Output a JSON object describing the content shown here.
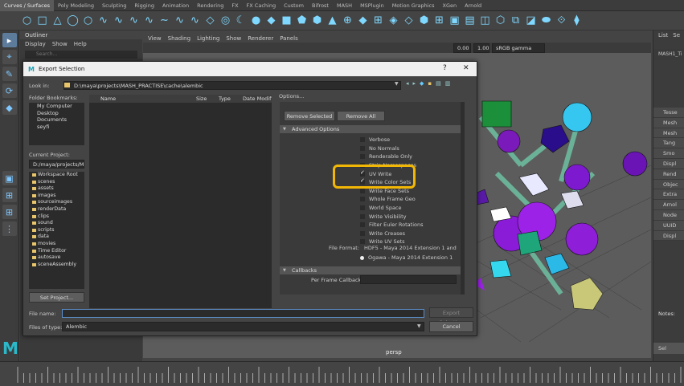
{
  "shelf": {
    "tabs": [
      "Curves / Surfaces",
      "Poly Modeling",
      "Sculpting",
      "Rigging",
      "Animation",
      "Rendering",
      "FX",
      "FX Caching",
      "Custom",
      "Bifrost",
      "MASH",
      "MSPlugin",
      "Motion Graphics",
      "XGen",
      "Arnold"
    ],
    "active_tab": "Curves / Surfaces",
    "icons": [
      "○",
      "□",
      "△",
      "◯",
      "○",
      "∿",
      "∿",
      "∿",
      "∿",
      "∼",
      "∿",
      "∿",
      "◇",
      "◎",
      "☾",
      "●",
      "◆",
      "■",
      "⬟",
      "⬢",
      "▲",
      "⊕",
      "◆",
      "⊞",
      "◈",
      "◇",
      "⬢",
      "⊞",
      "▣",
      "▤",
      "◫",
      "⬡",
      "⧉",
      "◪",
      "⬬",
      "⟐",
      "⧫"
    ]
  },
  "toolbox": {
    "tools": [
      "▸",
      "⌖",
      "✎",
      "⟳",
      "◆",
      "▣",
      "⊞",
      "⊞",
      "⋮"
    ]
  },
  "logo_text": "M",
  "outliner": {
    "title": "Outliner",
    "menu": [
      "Display",
      "Show",
      "Help"
    ],
    "search_placeholder": "Search..."
  },
  "viewport": {
    "menu": [
      "View",
      "Shading",
      "Lighting",
      "Show",
      "Renderer",
      "Panels"
    ],
    "exposure": "0.00",
    "gamma": "1.00",
    "colorspace": "sRGB gamma",
    "camera_label": "persp"
  },
  "right_panel": {
    "tabs": [
      "List",
      "Se"
    ],
    "node_name": "MASH1_Ti",
    "items": [
      "Tesse",
      "Mesh",
      "Mesh",
      "Tang",
      "Smo",
      "Displ",
      "Rend",
      "Objec",
      "Extra",
      "Arnol",
      "Node",
      "UUID",
      "Displ"
    ],
    "notes": "Notes:",
    "button": "Sel"
  },
  "dialog": {
    "title": "Export Selection",
    "help": "?",
    "close": "✕",
    "look_in_label": "Look in:",
    "look_in_path": "D:\\maya\\projects\\MASH_PRACTISE\\cache\\alembic",
    "folder_bookmarks_label": "Folder Bookmarks:",
    "bookmarks": [
      "My Computer",
      "Desktop",
      "Documents",
      "seyfi"
    ],
    "current_project_label": "Current Project:",
    "current_project": "D:/maya/projects/M",
    "project_folders": [
      "Workspace Root",
      "scenes",
      "assets",
      "images",
      "sourceimages",
      "renderData",
      "clips",
      "sound",
      "scripts",
      "data",
      "movies",
      "Time Editor",
      "autosave",
      "sceneAssembly"
    ],
    "set_project_button": "Set Project...",
    "columns": [
      "Name",
      "Size",
      "Type",
      "Date Modifi"
    ],
    "file_name_label": "File name:",
    "file_name_value": "",
    "files_of_type_label": "Files of type:",
    "files_of_type_value": "Alembic",
    "export_button": "Export Selection",
    "cancel_button": "Cancel",
    "options": {
      "header": "Options...",
      "remove_selected": "Remove Selected",
      "remove_all": "Remove All",
      "advanced_section": "Advanced Options",
      "checkboxes": [
        {
          "label": "Verbose",
          "checked": false
        },
        {
          "label": "No Normals",
          "checked": false
        },
        {
          "label": "Renderable Only",
          "checked": false
        },
        {
          "label": "Strip Namespaces",
          "checked": false
        },
        {
          "label": "UV Write",
          "checked": true
        },
        {
          "label": "Write Color Sets",
          "checked": true
        },
        {
          "label": "Write Face Sets",
          "checked": false
        },
        {
          "label": "Whole Frame Geo",
          "checked": false
        },
        {
          "label": "World Space",
          "checked": false
        },
        {
          "label": "Write Visibility",
          "checked": false
        },
        {
          "label": "Filter Euler Rotations",
          "checked": false
        },
        {
          "label": "Write Creases",
          "checked": false
        },
        {
          "label": "Write UV Sets",
          "checked": false
        }
      ],
      "file_format_label": "File Format:",
      "file_format_options": [
        "HDF5 - Maya 2014 Extension 1 and Legacy",
        "Ogawa - Maya 2014 Extension 1"
      ],
      "file_format_selected": "Ogawa - Maya 2014 Extension 1",
      "callbacks_section": "Callbacks",
      "per_frame_label": "Per Frame Callback MEL:"
    }
  },
  "highlight_color": "#f2b705",
  "timeline_ticks": [
    "",
    "",
    "",
    "",
    "",
    "",
    "",
    "",
    "",
    "",
    "",
    "",
    "",
    "",
    "",
    "",
    "",
    "",
    "",
    "",
    "",
    "",
    "",
    ""
  ]
}
